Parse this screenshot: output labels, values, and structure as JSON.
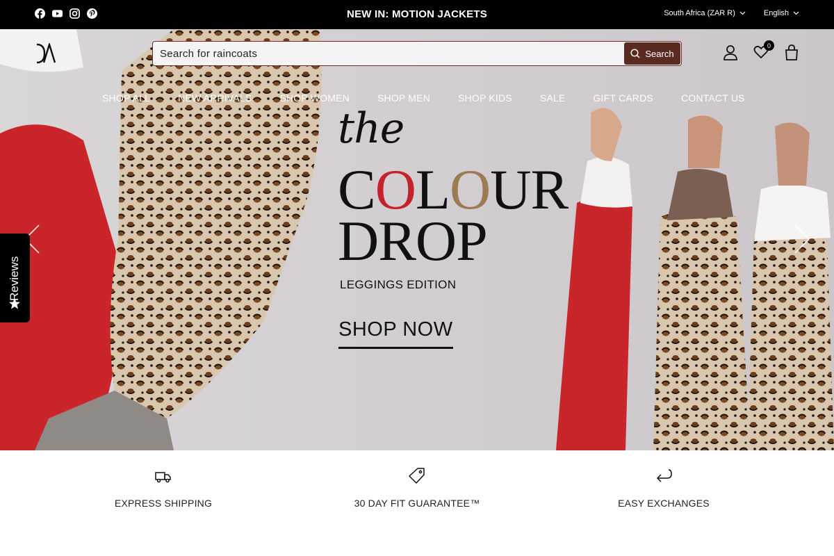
{
  "topbar": {
    "social_icons": [
      "facebook-icon",
      "youtube-icon",
      "instagram-icon",
      "pinterest-icon"
    ],
    "announcement": "NEW IN: MOTION JACKETS",
    "country_selector": "South Africa (ZAR R)",
    "language_selector": "English"
  },
  "header": {
    "search": {
      "placeholder": "Search for raincoats",
      "button_label": "Search"
    },
    "wishlist_count": "0",
    "icons": [
      "account-icon",
      "wishlist-heart-icon",
      "cart-bag-icon"
    ]
  },
  "nav": {
    "items": [
      "SHOP ALL",
      "NEW ARRIVALS",
      "SHOP WOMEN",
      "SHOP MEN",
      "SHOP KIDS",
      "SALE",
      "GIFT CARDS",
      "CONTACT US"
    ]
  },
  "hero": {
    "line1": "the",
    "line2_parts": [
      "C",
      "O",
      "L",
      "O",
      "UR"
    ],
    "line3": "DROP",
    "subtitle": "LEGGINGS EDITION",
    "cta": "SHOP NOW"
  },
  "reviews_tab": {
    "label": "Reviews"
  },
  "features": [
    {
      "icon": "truck-icon",
      "label": "EXPRESS SHIPPING"
    },
    {
      "icon": "tag-icon",
      "label": "30 DAY FIT GUARANTEE™"
    },
    {
      "icon": "return-arrow-icon",
      "label": "EASY EXCHANGES"
    }
  ],
  "colors": {
    "accent_brown": "#5a2a20",
    "colour_red": "#c4232b",
    "colour_tan": "#9c7a52"
  }
}
